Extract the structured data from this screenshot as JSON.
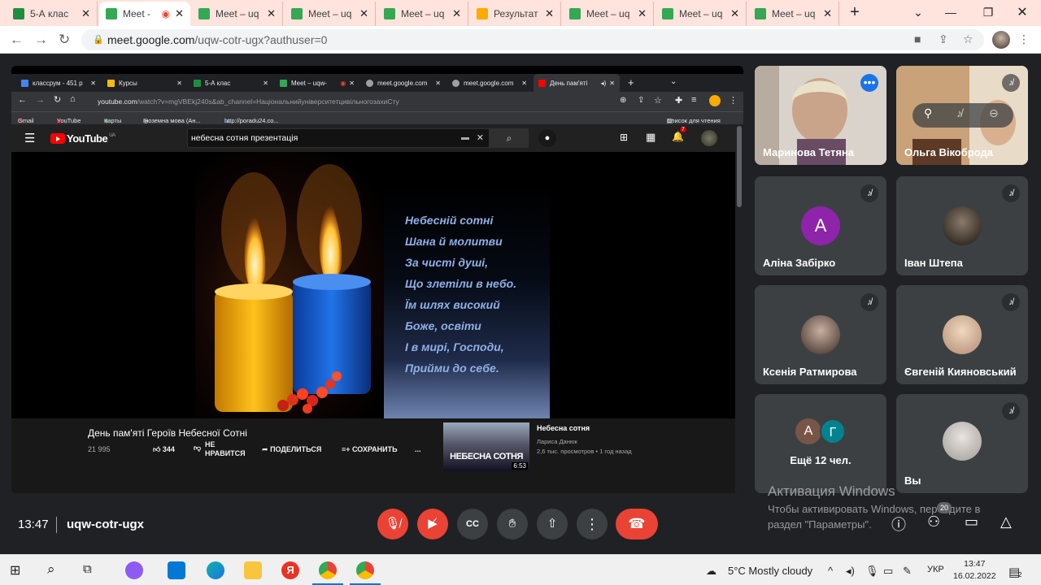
{
  "outer_tabs": [
    {
      "title": "5-А клас",
      "color": "#1e8e3e"
    },
    {
      "title": "Meet -",
      "color": "#34a853",
      "recording": true
    },
    {
      "title": "Meet – uq",
      "color": "#34a853"
    },
    {
      "title": "Meet – uq",
      "color": "#34a853"
    },
    {
      "title": "Meet – uq",
      "color": "#34a853"
    },
    {
      "title": "Результат",
      "color": "#f9ab00"
    },
    {
      "title": "Meet – uq",
      "color": "#34a853"
    },
    {
      "title": "Meet – uq",
      "color": "#34a853"
    },
    {
      "title": "Meet – uq",
      "color": "#34a853"
    }
  ],
  "address": {
    "host": "meet.google.com",
    "path": "/uqw-cotr-ugx?authuser=0"
  },
  "shared_browser": {
    "tabs": [
      {
        "title": "классрум - 451 р",
        "color": "#4285f4"
      },
      {
        "title": "Курсы",
        "color": "#fbbc04"
      },
      {
        "title": "5-А клас",
        "color": "#1e8e3e"
      },
      {
        "title": "Meet – uqw-",
        "color": "#34a853"
      },
      {
        "title": "meet.google.com",
        "color": "#9aa0a6"
      },
      {
        "title": "meet.google.com",
        "color": "#9aa0a6"
      },
      {
        "title": "День пам'яті",
        "color": "#ff0000"
      }
    ],
    "url_host": "youtube.com",
    "url_path": "/watch?v=mgVBEkj240s&ab_channel=НаціональнийуніверситетцивільногозахиСту",
    "bookmarks": [
      "Gmail",
      "YouTube",
      "Карты",
      "Іноземна мова (Ан...",
      "http://poradu24.co...",
      "Список для чтения"
    ],
    "youtube": {
      "logo": "YouTube",
      "region": "UA",
      "search_value": "небесна сотня презентація",
      "notifications": "7",
      "poem": [
        "Небесній сотні",
        "Шана  й молитви",
        "За чисті душі,",
        "Що злетіли в небо.",
        "Їм шлях високий",
        "Боже, освіти",
        "І в мирі, Господи,",
        "Прийми до себе."
      ],
      "video_title": "День пам'яті Героїв Небесної Сотні",
      "views": "21 995",
      "likes": "344",
      "dislike": "НЕ НРАВИТСЯ",
      "share": "ПОДЕЛИТЬСЯ",
      "save": "СОХРАНИТЬ",
      "more": "...",
      "rec_title": "Небесна сотня",
      "rec_channel": "Лариса Данюк",
      "rec_meta": "2,6 тыс. просмотров • 1 год назад",
      "rec_thumb_text": "НЕБЕСНА СОТНЯ",
      "rec_duration": "6:53"
    }
  },
  "participants": [
    {
      "name": "Маринова Тетяна",
      "type": "camera"
    },
    {
      "name": "Ольга Вікоброда",
      "type": "camera"
    },
    {
      "name": "Аліна Забірко",
      "initial": "А",
      "color": "#8e24aa"
    },
    {
      "name": "Іван Штепа",
      "type": "photo"
    },
    {
      "name": "Ксенія Ратмирова",
      "type": "photo"
    },
    {
      "name": "Євгеній Кияновський",
      "type": "photo"
    },
    {
      "name": "Ещё 12 чел.",
      "initials": [
        "А",
        "Г"
      ]
    },
    {
      "name": "Вы",
      "type": "photo"
    }
  ],
  "meeting": {
    "time": "13:47",
    "code": "uqw-cotr-ugx",
    "people_count": "20"
  },
  "activation": {
    "line1": "Активация Windows",
    "line2": "Чтобы активировать Windows, перейдите в",
    "line3": "раздел \"Параметры\"."
  },
  "taskbar": {
    "weather": "5°C  Mostly cloudy",
    "lang": "УКР",
    "time": "13:47",
    "date": "16.02.2022",
    "notif": "2"
  }
}
